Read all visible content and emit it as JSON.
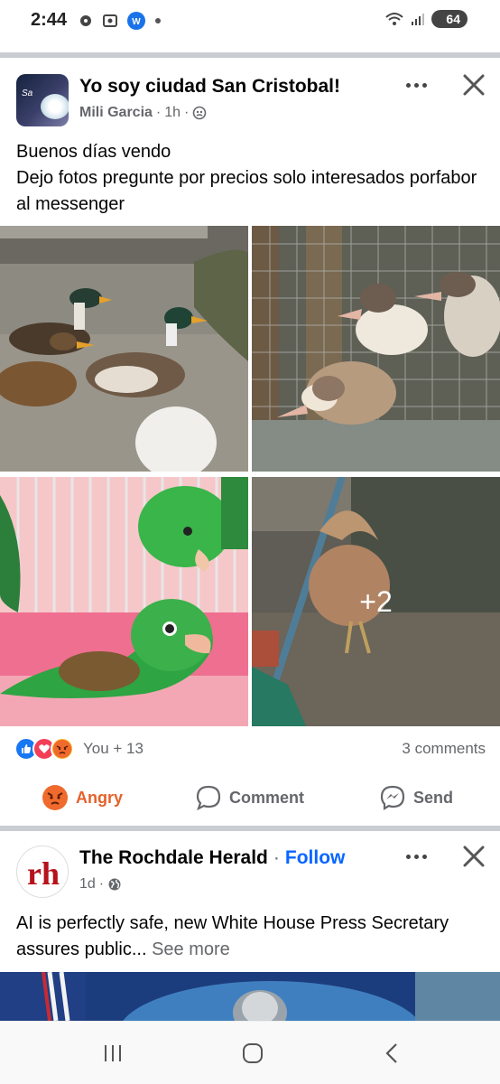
{
  "status_bar": {
    "time": "2:44",
    "battery": "64",
    "left_icons": [
      "gear-icon",
      "screenshot-icon",
      "app-icon",
      "dot-icon"
    ],
    "right_icons": [
      "wifi-icon",
      "signal-icon",
      "battery-icon"
    ]
  },
  "post1": {
    "group_name": "Yo soy ciudad San Cristobal!",
    "author": "Mili Garcia",
    "time": "1h",
    "privacy_icon": "group-icon",
    "body_lines": [
      "Buenos días vendo",
      "Dejo fotos pregunte por precios solo interesados porfabor al messenger"
    ],
    "photos": [
      {
        "name": "ducks-on-concrete"
      },
      {
        "name": "ducklings-in-cage"
      },
      {
        "name": "green-parakeets"
      },
      {
        "name": "frizzle-chicken"
      }
    ],
    "more_photos": "+2",
    "reactions": [
      "like",
      "love",
      "angry"
    ],
    "reaction_text": "You + 13",
    "comments_text": "3 comments",
    "actions": {
      "angry": "Angry",
      "comment": "Comment",
      "send": "Send"
    }
  },
  "post2": {
    "page_name": "The Rochdale Herald",
    "separator": "·",
    "follow_label": "Follow",
    "time": "1d",
    "privacy_icon": "globe-icon",
    "body": "AI is perfectly safe, new White House Press Secretary assures public...",
    "see_more": "See more"
  },
  "colors": {
    "accent_blue": "#0866ff",
    "angry_orange": "#e4612a",
    "separator_gray": "#c9ccd1",
    "secondary_text": "#65676b"
  }
}
